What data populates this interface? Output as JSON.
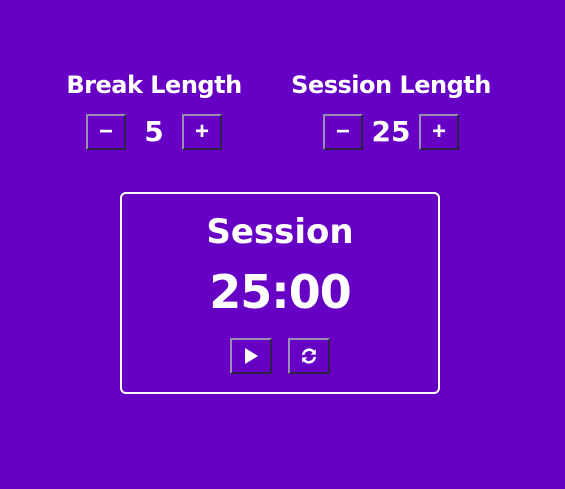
{
  "break": {
    "title": "Break Length",
    "value": "5",
    "decrement_label": "−",
    "increment_label": "+"
  },
  "session": {
    "title": "Session Length",
    "value": "25",
    "decrement_label": "−",
    "increment_label": "+"
  },
  "timer": {
    "label": "Session",
    "time": "25:00",
    "play_icon": "play-icon",
    "reset_icon": "refresh-icon"
  },
  "colors": {
    "background": "#6600c5",
    "text": "#ffffff",
    "border": "#ffffff"
  }
}
